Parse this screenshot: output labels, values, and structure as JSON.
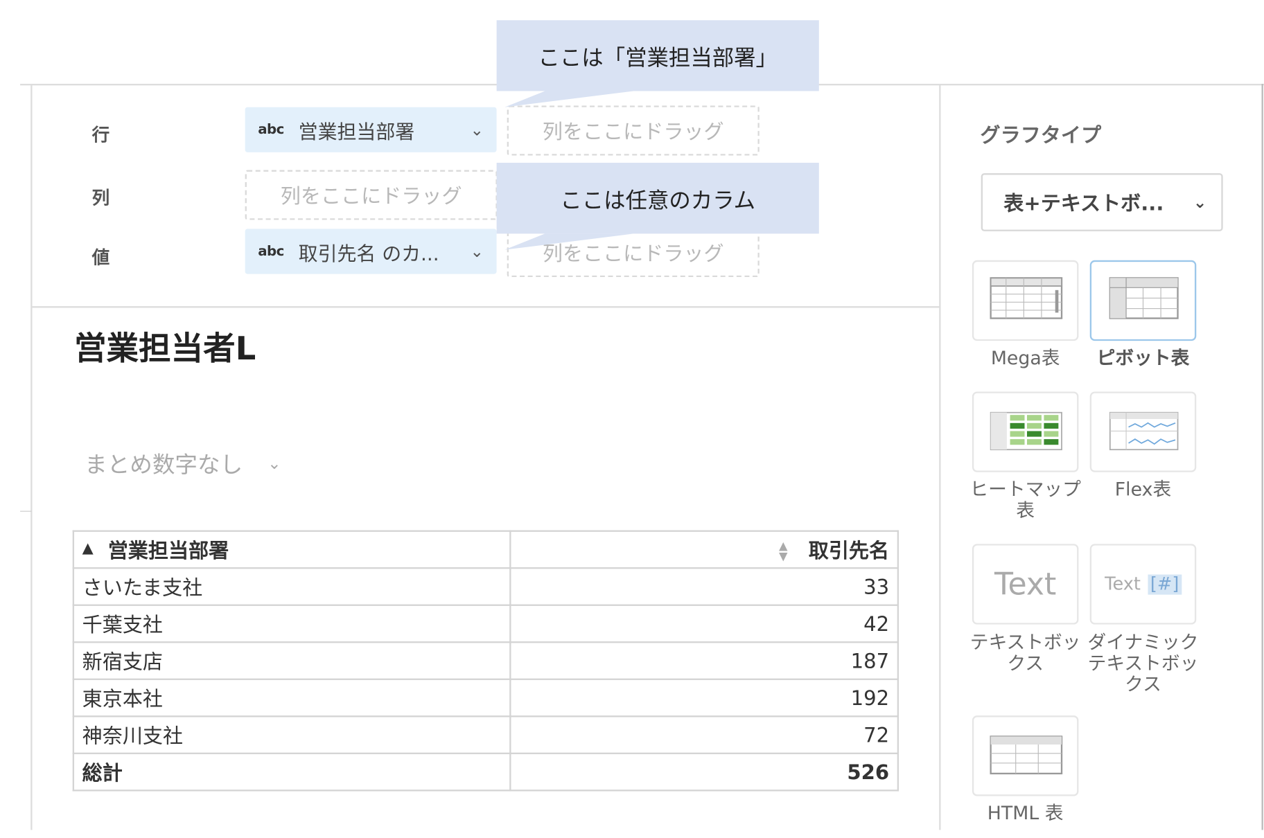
{
  "callouts": {
    "first": "ここは「営業担当部署」",
    "second": "ここは任意のカラム"
  },
  "shelves": {
    "row_label": "行",
    "col_label": "列",
    "value_label": "値",
    "row_pill": {
      "type": "abc",
      "text": "営業担当部署"
    },
    "value_pill": {
      "type": "abc",
      "text": "取引先名 のカ..."
    },
    "drop_placeholder": "列をここにドラッグ"
  },
  "report": {
    "title": "営業担当者L",
    "summary_select": "まとめ数字なし"
  },
  "table": {
    "headers": [
      "営業担当部署",
      "取引先名"
    ],
    "rows": [
      [
        "さいたま支社",
        "33"
      ],
      [
        "千葉支社",
        "42"
      ],
      [
        "新宿支店",
        "187"
      ],
      [
        "東京本社",
        "192"
      ],
      [
        "神奈川支社",
        "72"
      ]
    ],
    "total": [
      "総計",
      "526"
    ]
  },
  "sidebar": {
    "graph_type_title": "グラフタイプ",
    "selected_type": "表+テキストボ...",
    "tiles": [
      {
        "label": "Mega表",
        "icon": "mega-table-icon"
      },
      {
        "label": "ピボット表",
        "icon": "pivot-table-icon",
        "selected": true
      },
      {
        "label": "ヒートマップ表",
        "icon": "heatmap-table-icon"
      },
      {
        "label": "Flex表",
        "icon": "flex-table-icon"
      },
      {
        "label": "テキストボックス",
        "icon": "text-box-icon",
        "preview": "Text"
      },
      {
        "label": "ダイナミックテキストボックス",
        "icon": "dynamic-text-box-icon",
        "preview": "Text",
        "preview_tag": "[#]"
      },
      {
        "label": "HTML 表",
        "icon": "html-table-icon"
      }
    ]
  },
  "colors": {
    "callout_bg": "#d9e2f3",
    "pill_bg": "#e3f0fb",
    "heatmap_dark": "#3a8a2e",
    "heatmap_light": "#a8d48a"
  }
}
